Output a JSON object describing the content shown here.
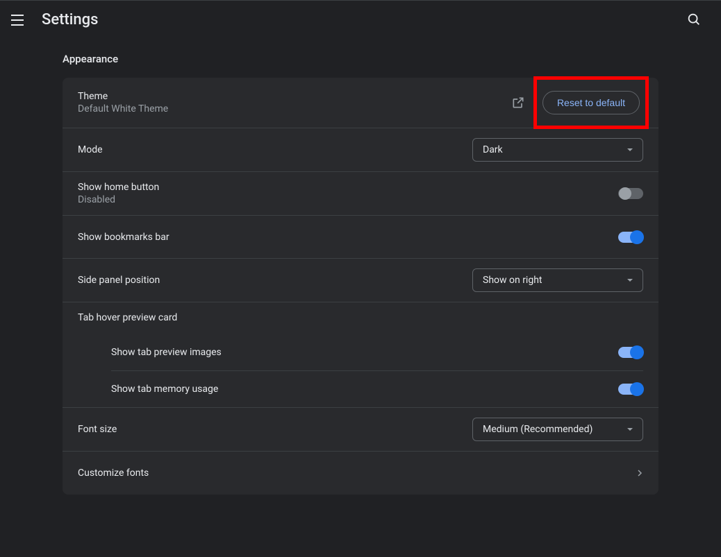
{
  "header": {
    "title": "Settings"
  },
  "section": {
    "title": "Appearance"
  },
  "theme": {
    "label": "Theme",
    "value": "Default White Theme",
    "reset_label": "Reset to default"
  },
  "mode": {
    "label": "Mode",
    "value": "Dark"
  },
  "home_button": {
    "label": "Show home button",
    "status": "Disabled",
    "enabled": false
  },
  "bookmarks_bar": {
    "label": "Show bookmarks bar",
    "enabled": true
  },
  "side_panel": {
    "label": "Side panel position",
    "value": "Show on right"
  },
  "tab_hover": {
    "label": "Tab hover preview card",
    "preview_images": {
      "label": "Show tab preview images",
      "enabled": true
    },
    "memory_usage": {
      "label": "Show tab memory usage",
      "enabled": true
    }
  },
  "font_size": {
    "label": "Font size",
    "value": "Medium (Recommended)"
  },
  "customize_fonts": {
    "label": "Customize fonts"
  }
}
